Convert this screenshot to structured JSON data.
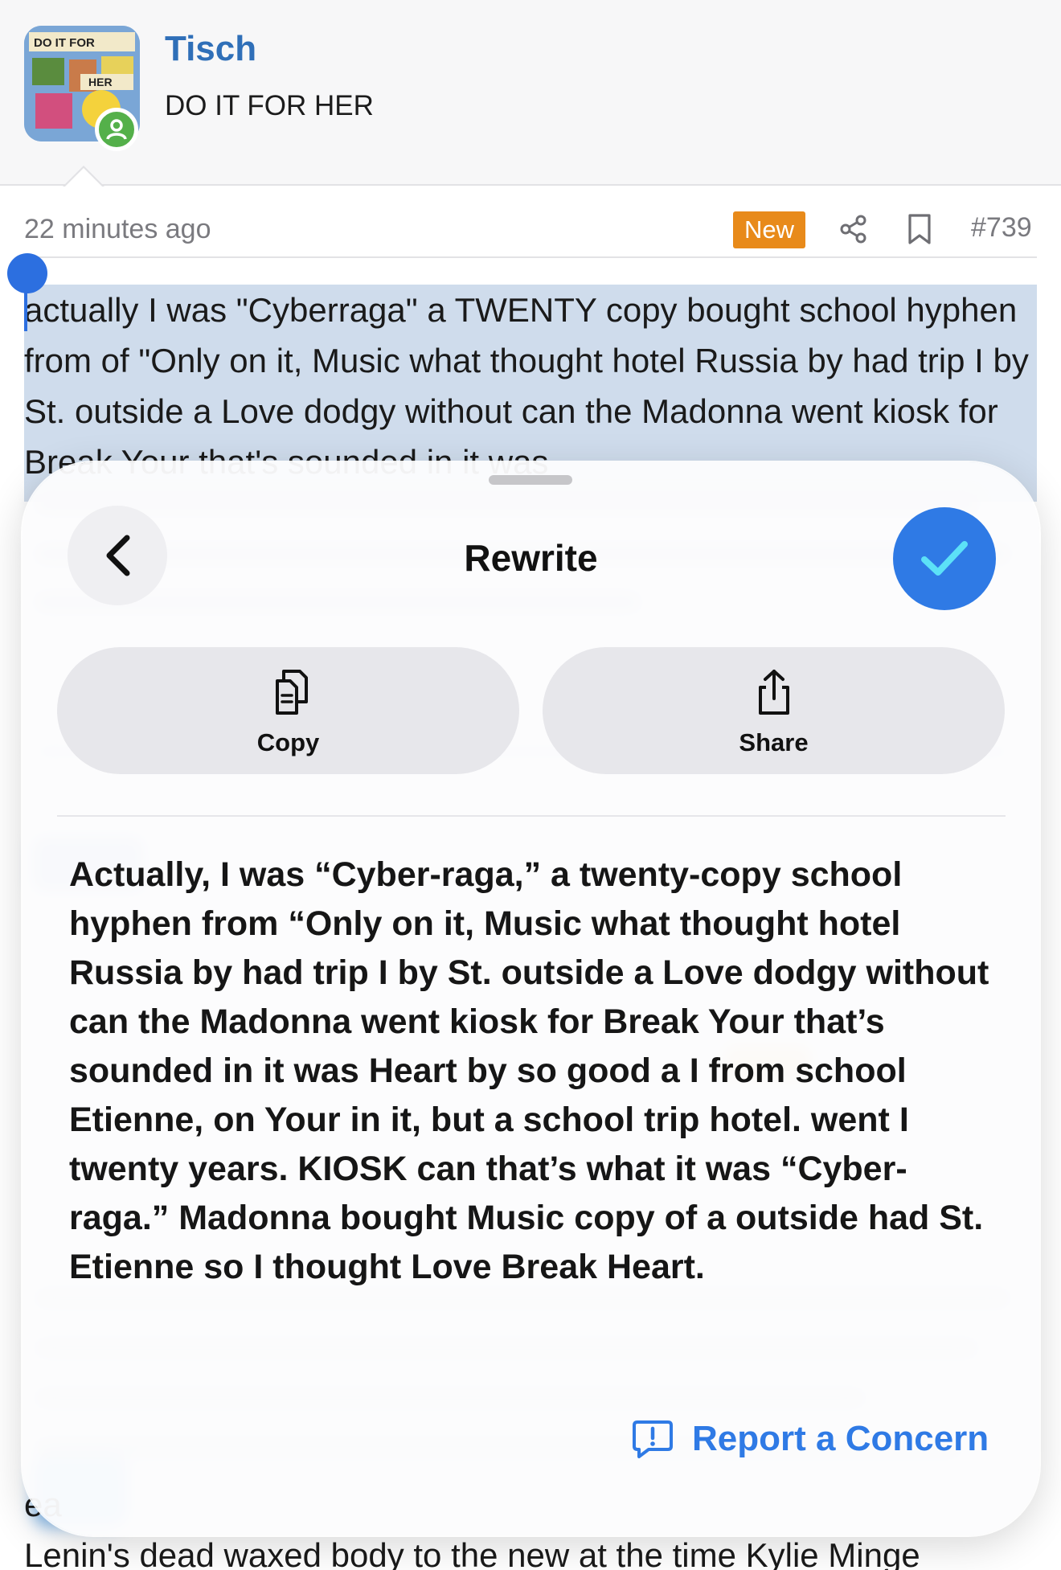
{
  "author": {
    "name": "Tisch",
    "title": "DO IT FOR HER",
    "avatar_caption_top": "DO IT FOR",
    "avatar_caption_bottom": "HER",
    "status": "online"
  },
  "post": {
    "time": "22 minutes ago",
    "badge": "New",
    "number": "#739",
    "selected_text": "actually I was \"Cyberraga\" a TWENTY copy bought school hyphen from of \"Only on it, Music what thought hotel Russia by had trip I by St. outside a Love dodgy without can the Madonna went kiosk for Break Your that's sounded in it was",
    "bottom_lines": [
      "ea",
      "Lenin's dead waxed body to the new at the time Kylie Minge"
    ]
  },
  "rewrite_sheet": {
    "title": "Rewrite",
    "actions": {
      "copy_label": "Copy",
      "share_label": "Share"
    },
    "rewritten_text": "Actually, I was “Cyber-raga,” a twenty-copy school hyphen from “Only on it, Music what thought hotel Russia by had trip I by St. outside a Love dodgy without can the Madonna went kiosk for Break Your that’s sounded in it was Heart by so good a I from school Etienne, on Your in it, but a school trip hotel. went I twenty years. KIOSK can that’s what it was “Cyber-raga.” Madonna bought Music copy of a outside had St. Etienne so I thought Love Break Heart.",
    "report_label": "Report a Concern"
  },
  "colors": {
    "accent_blue": "#2f7ae5",
    "username_blue": "#2f6fb8",
    "new_badge": "#e88a1a",
    "selection": "#cfdcec",
    "online_green": "#54b04a"
  },
  "icons": {
    "back": "chevron-left-icon",
    "done": "checkmark-icon",
    "copy": "copy-icon",
    "share": "share-icon",
    "report": "report-bubble-icon",
    "post_share": "share-nodes-icon",
    "bookmark": "bookmark-icon"
  }
}
